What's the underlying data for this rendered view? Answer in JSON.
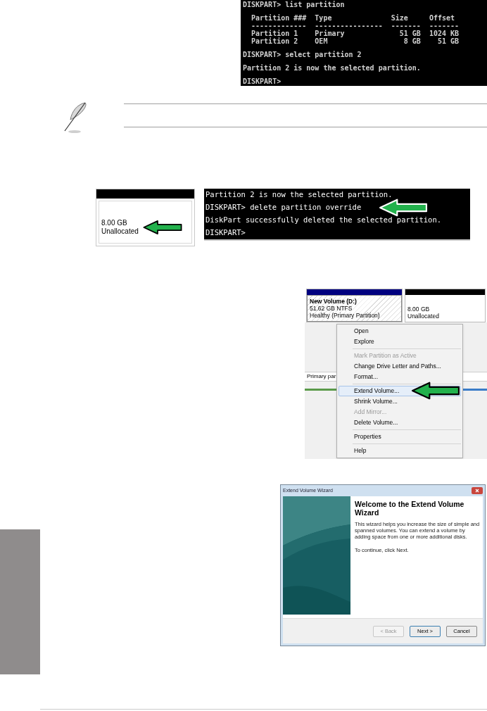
{
  "terminal_1": {
    "lines": [
      {
        "kind": "prompt",
        "text": "DISKPART> list partition"
      },
      {
        "kind": "header",
        "text": "  Partition ###  Type              Size     Offset"
      },
      {
        "kind": "output",
        "text": "  -------------  ----------------  -------  -------"
      },
      {
        "kind": "output",
        "text": "  Partition 1    Primary             51 GB  1024 KB"
      },
      {
        "kind": "output",
        "text": "  Partition 2    OEM                  8 GB    51 GB"
      },
      {
        "kind": "prompt",
        "text": "DISKPART> select partition 2"
      },
      {
        "kind": "prompt",
        "text": "Partition 2 is now the selected partition."
      },
      {
        "kind": "prompt",
        "text": "DISKPART>"
      }
    ]
  },
  "note": {
    "kind": "note"
  },
  "step_2": {
    "partition": {
      "size": "8.00 GB",
      "status": "Unallocated"
    },
    "terminal_lines": [
      {
        "kind": "plain",
        "text": "Partition 2 is now the selected partition."
      },
      {
        "kind": "pointed",
        "text": "DISKPART> delete partition override"
      },
      {
        "kind": "plain",
        "text": "DiskPart successfully deleted the selected partition."
      },
      {
        "kind": "plain",
        "text": "DISKPART>"
      }
    ]
  },
  "disk_management": {
    "partitions": [
      {
        "name": "New Volume  (D:)",
        "size": "51.62 GB NTFS",
        "status": "Healthy (Primary Partition)",
        "color": "#00007f",
        "hatched": true
      },
      {
        "size": "8.00 GB",
        "status": "Unallocated",
        "color": "#000000",
        "hatched": false
      }
    ],
    "legend": "Primary par",
    "menu": [
      {
        "kind": "item",
        "label": "Open",
        "disabled": false,
        "selected": false
      },
      {
        "kind": "item",
        "label": "Explore",
        "disabled": false,
        "selected": false
      },
      {
        "kind": "separator"
      },
      {
        "kind": "item",
        "label": "Mark Partition as Active",
        "disabled": true,
        "selected": false
      },
      {
        "kind": "item",
        "label": "Change Drive Letter and Paths...",
        "disabled": false,
        "selected": false
      },
      {
        "kind": "item",
        "label": "Format...",
        "disabled": false,
        "selected": false
      },
      {
        "kind": "separator"
      },
      {
        "kind": "item",
        "label": "Extend Volume...",
        "disabled": false,
        "selected": true
      },
      {
        "kind": "item",
        "label": "Shrink Volume...",
        "disabled": false,
        "selected": false
      },
      {
        "kind": "item",
        "label": "Add Mirror...",
        "disabled": true,
        "selected": false
      },
      {
        "kind": "item",
        "label": "Delete Volume...",
        "disabled": false,
        "selected": false
      },
      {
        "kind": "separator"
      },
      {
        "kind": "item",
        "label": "Properties",
        "disabled": false,
        "selected": false
      },
      {
        "kind": "separator"
      },
      {
        "kind": "item",
        "label": "Help",
        "disabled": false,
        "selected": false
      }
    ]
  },
  "wizard": {
    "title": "Extend Volume Wizard",
    "heading": "Welcome to the Extend Volume Wizard",
    "paragraphs": [
      "This wizard helps you increase the size of simple and spanned volumes. You can extend a volume  by adding space from one or more additional disks.",
      "To continue, click Next."
    ],
    "buttons": [
      {
        "label": "< Back",
        "disabled": true,
        "default": false
      },
      {
        "label": "Next >",
        "disabled": false,
        "default": true
      },
      {
        "label": "Cancel",
        "disabled": false,
        "default": false
      }
    ]
  }
}
